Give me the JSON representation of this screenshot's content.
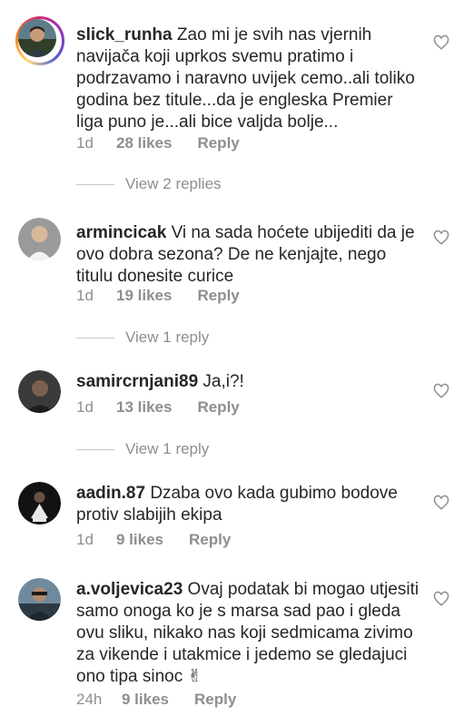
{
  "comments": [
    {
      "username": "slick_runha",
      "text": "Zao mi je svih nas vjernih navijača koji uprkos svemu pratimo i podrzavamo i naravno uvijek cemo..ali toliko godina bez titule...da je engleska Premier liga puno je...ali bice valjda bolje...",
      "time": "1d",
      "likes": "28 likes",
      "reply": "Reply",
      "view_replies": "View 2 replies"
    },
    {
      "username": "armincicak",
      "text": "Vi na sada hoćete ubijediti da je ovo dobra sezona? De ne kenjajte, nego titulu donesite curice",
      "time": "1d",
      "likes": "19 likes",
      "reply": "Reply",
      "view_replies": "View 1 reply"
    },
    {
      "username": "samircrnjani89",
      "text": "Ja,i?!",
      "time": "1d",
      "likes": "13 likes",
      "reply": "Reply",
      "view_replies": "View 1 reply"
    },
    {
      "username": "aadin.87",
      "text": "Dzaba ovo kada gubimo bodove protiv slabijih ekipa",
      "time": "1d",
      "likes": "9 likes",
      "reply": "Reply"
    },
    {
      "username": "a.voljevica23",
      "text": "Ovaj podatak bi mogao utjesiti samo onoga ko je s marsa sad pao i gleda ovu sliku, nikako nas koji sedmicama zivimo za vikende i utakmice i jedemo se gledajuci ono tipa sinoc ✌",
      "time": "24h",
      "likes": "9 likes",
      "reply": "Reply"
    }
  ],
  "icons": {
    "like": "heart-outline-icon"
  },
  "colors": {
    "text": "#262626",
    "meta": "#8e8e8e",
    "story_ring": "#d62976"
  }
}
